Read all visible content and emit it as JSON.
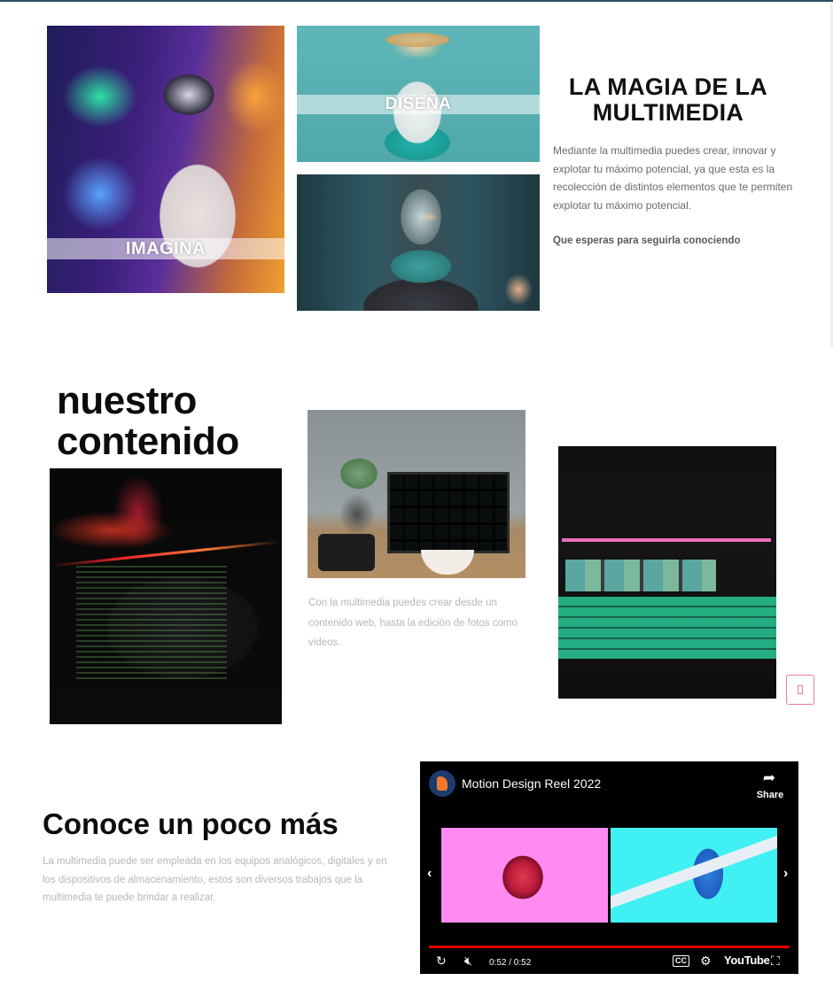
{
  "section_intro": {
    "images": [
      {
        "name": "imagina",
        "caption": "IMAGINA"
      },
      {
        "name": "disena",
        "caption": "DISEÑA"
      },
      {
        "name": "goldfish",
        "caption": ""
      }
    ],
    "title": "LA MAGIA DE LA MULTIMEDIA",
    "body": "Mediante la multimedia puedes crear, innovar y explotar tu máximo potencial, ya que esta es la recolección de distintos elementos que te permiten explotar tu máximo potencial.",
    "cta": "Que esperas para seguirla conociendo"
  },
  "section_content": {
    "title": "nuestro contenido",
    "body": "Con la multimedia puedes crear desde un contenido web, hasta la edición de fotos como videos."
  },
  "section_more": {
    "title": "Conoce un poco más",
    "body": "La multimedia puede ser empleada en los equipos analógicos, digitales y en los dispositivos de almacenamiento, estos son diversos trabajos que la multimedia te puede brindar a realizar."
  },
  "video": {
    "title": "Motion Design Reel 2022",
    "share_label": "Share",
    "time": "0:52 / 0:52",
    "cc_label": "CC",
    "logo": "YouTube",
    "progress": 1.0,
    "icons": {
      "share": "share-icon",
      "prev": "chevron-left-icon",
      "next": "chevron-right-icon",
      "replay": "replay-icon",
      "mute": "mute-icon",
      "settings": "gear-icon",
      "fullscreen": "fullscreen-icon"
    }
  },
  "colors": {
    "accent": "#ef7a9e",
    "progress": "#e10000",
    "topline": "#2c4e66"
  }
}
